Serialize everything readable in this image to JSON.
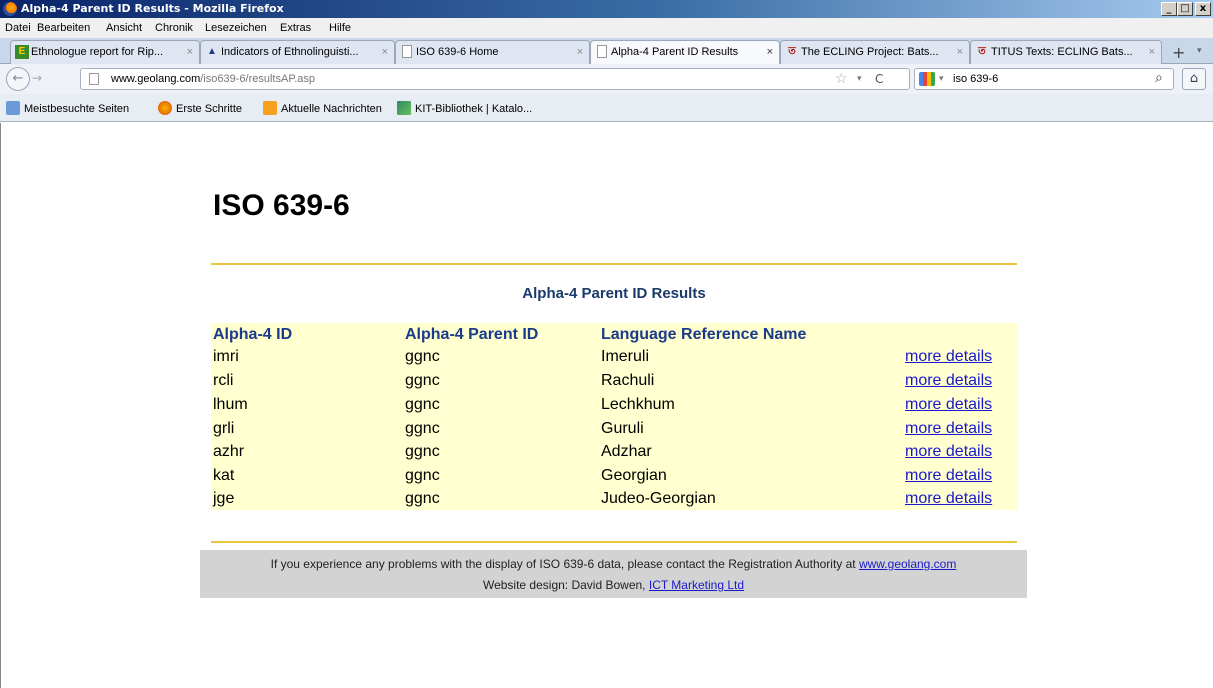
{
  "window": {
    "title": "Alpha-4 Parent ID Results - Mozilla Firefox"
  },
  "menu": [
    "Datei",
    "Bearbeiten",
    "Ansicht",
    "Chronik",
    "Lesezeichen",
    "Extras",
    "Hilfe"
  ],
  "tabs": [
    {
      "label": "Ethnologue report for Rip...",
      "icon": "ethnologue-icon"
    },
    {
      "label": "Indicators of Ethnolinguisti...",
      "icon": "triangle-logo-icon"
    },
    {
      "label": "ISO 639-6 Home",
      "icon": "page-icon"
    },
    {
      "label": "Alpha-4 Parent ID Results",
      "icon": "page-icon"
    },
    {
      "label": "The ECLING Project: Bats...",
      "icon": "titus-icon"
    },
    {
      "label": "TITUS Texts: ECLING Bats...",
      "icon": "titus-icon"
    }
  ],
  "nav": {
    "url_domain": "www.geolang.com",
    "url_path": "/iso639-6/resultsAP.asp",
    "search_value": "iso 639-6"
  },
  "bookmarks": [
    "Meistbesuchte Seiten",
    "Erste Schritte",
    "Aktuelle Nachrichten",
    "KIT-Bibliothek | Katalo..."
  ],
  "page": {
    "site_title": "ISO 639-6",
    "results_title": "Alpha-4 Parent ID Results",
    "columns": [
      "Alpha-4 ID",
      "Alpha-4 Parent ID",
      "Language Reference Name"
    ],
    "rows": [
      {
        "id": "imri",
        "parent": "ggnc",
        "name": "Imeruli",
        "link": "more details"
      },
      {
        "id": "rcli",
        "parent": "ggnc",
        "name": "Rachuli",
        "link": "more details"
      },
      {
        "id": "lhum",
        "parent": "ggnc",
        "name": "Lechkhum",
        "link": "more details"
      },
      {
        "id": "grli",
        "parent": "ggnc",
        "name": "Guruli",
        "link": "more details"
      },
      {
        "id": "azhr",
        "parent": "ggnc",
        "name": "Adzhar",
        "link": "more details"
      },
      {
        "id": "kat",
        "parent": "ggnc",
        "name": "Georgian",
        "link": "more details"
      },
      {
        "id": "jge",
        "parent": "ggnc",
        "name": "Judeo-Georgian",
        "link": "more details"
      }
    ],
    "footer_line1": "If you experience any problems with the display of ISO 639-6 data, please contact the Registration Authority at",
    "footer_link1": "www.geolang.com",
    "footer_line2": "Website design: David Bowen,",
    "footer_link2": "ICT Marketing Ltd"
  }
}
